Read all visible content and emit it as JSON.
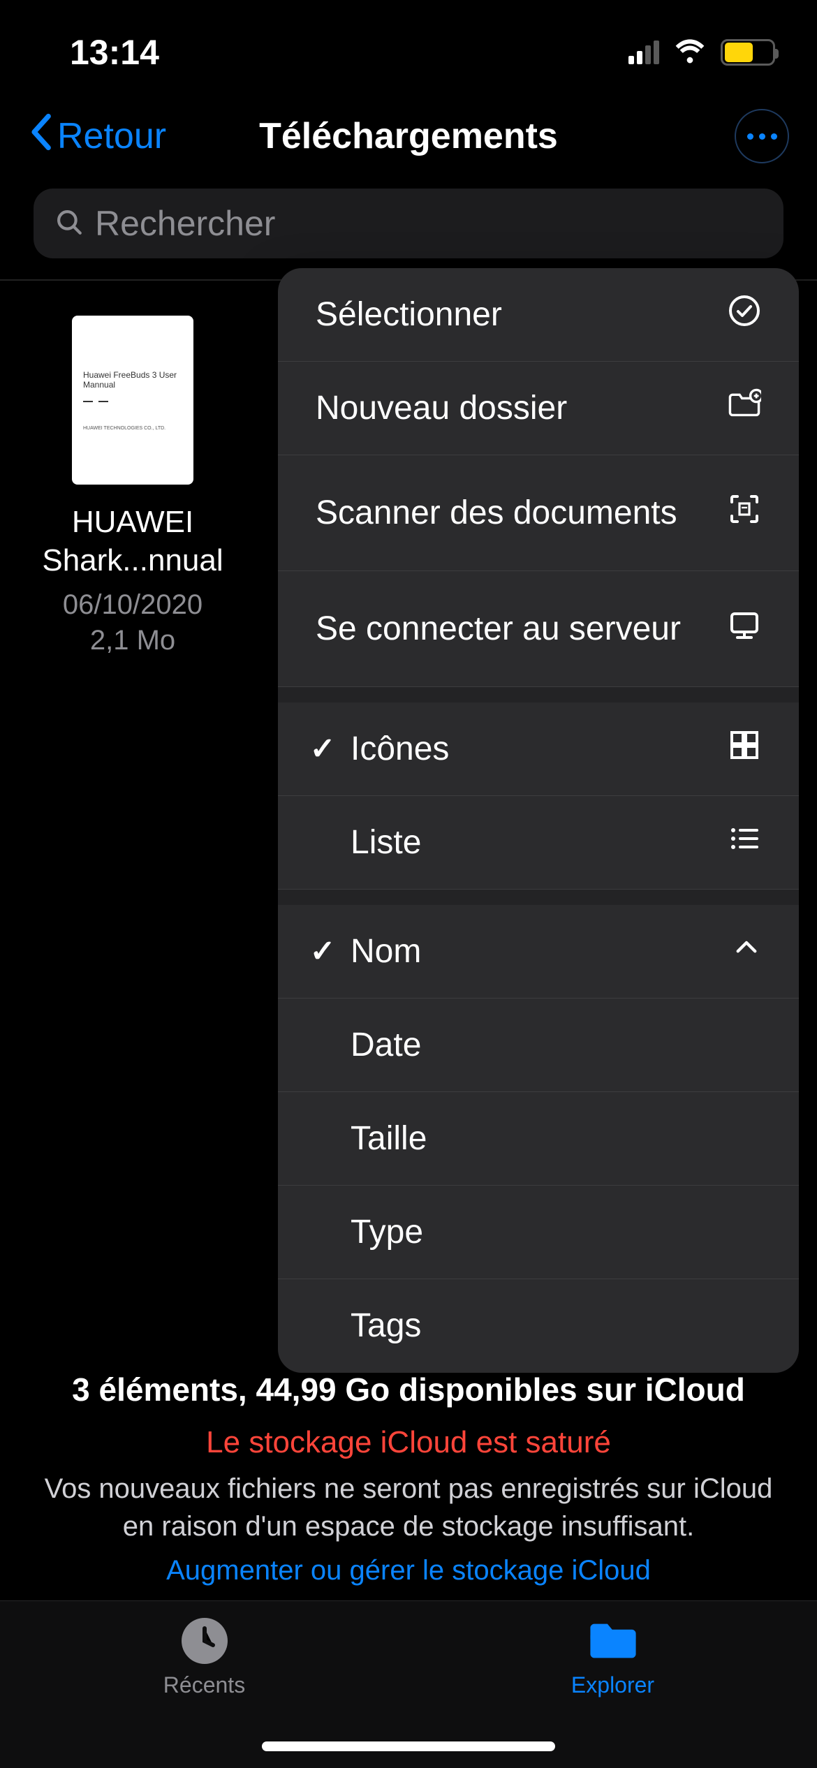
{
  "status": {
    "time": "13:14"
  },
  "nav": {
    "back_label": "Retour",
    "title": "Téléchargements"
  },
  "search": {
    "placeholder": "Rechercher"
  },
  "file": {
    "name_line1": "HUAWEI",
    "name_line2": "Shark...nnual",
    "date": "06/10/2020",
    "size": "2,1 Mo",
    "thumb_title": "Huawei FreeBuds 3 User Mannual"
  },
  "menu": {
    "select": "Sélectionner",
    "new_folder": "Nouveau dossier",
    "scan_docs": "Scanner des documents",
    "connect_server": "Se connecter au serveur",
    "icons": "Icônes",
    "list": "Liste",
    "name": "Nom",
    "date": "Date",
    "size": "Taille",
    "type": "Type",
    "tags": "Tags"
  },
  "footer": {
    "summary": "3 éléments, 44,99 Go disponibles sur iCloud",
    "warning_title": "Le stockage iCloud est saturé",
    "warning_text": "Vos nouveaux fichiers ne seront pas enregistrés sur iCloud en raison d'un espace de stockage insuffisant.",
    "storage_link": "Augmenter ou gérer le stockage iCloud"
  },
  "tabs": {
    "recents": "Récents",
    "browse": "Explorer"
  }
}
